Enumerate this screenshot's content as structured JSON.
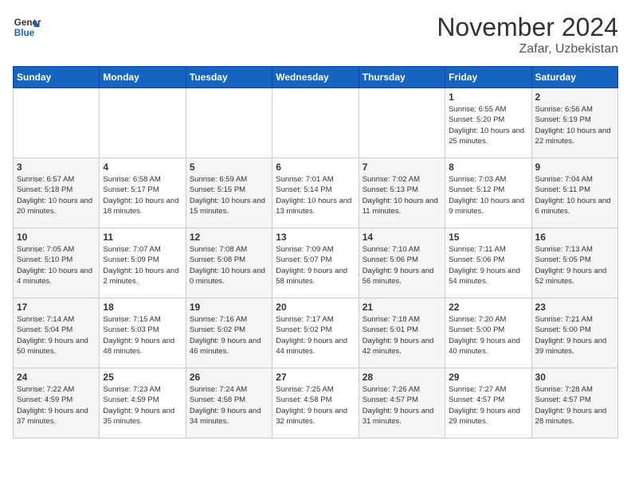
{
  "header": {
    "logo_line1": "General",
    "logo_line2": "Blue",
    "month": "November 2024",
    "location": "Zafar, Uzbekistan"
  },
  "weekdays": [
    "Sunday",
    "Monday",
    "Tuesday",
    "Wednesday",
    "Thursday",
    "Friday",
    "Saturday"
  ],
  "weeks": [
    [
      {
        "day": "",
        "info": ""
      },
      {
        "day": "",
        "info": ""
      },
      {
        "day": "",
        "info": ""
      },
      {
        "day": "",
        "info": ""
      },
      {
        "day": "",
        "info": ""
      },
      {
        "day": "1",
        "info": "Sunrise: 6:55 AM\nSunset: 5:20 PM\nDaylight: 10 hours and 25 minutes."
      },
      {
        "day": "2",
        "info": "Sunrise: 6:56 AM\nSunset: 5:19 PM\nDaylight: 10 hours and 22 minutes."
      }
    ],
    [
      {
        "day": "3",
        "info": "Sunrise: 6:57 AM\nSunset: 5:18 PM\nDaylight: 10 hours and 20 minutes."
      },
      {
        "day": "4",
        "info": "Sunrise: 6:58 AM\nSunset: 5:17 PM\nDaylight: 10 hours and 18 minutes."
      },
      {
        "day": "5",
        "info": "Sunrise: 6:59 AM\nSunset: 5:15 PM\nDaylight: 10 hours and 15 minutes."
      },
      {
        "day": "6",
        "info": "Sunrise: 7:01 AM\nSunset: 5:14 PM\nDaylight: 10 hours and 13 minutes."
      },
      {
        "day": "7",
        "info": "Sunrise: 7:02 AM\nSunset: 5:13 PM\nDaylight: 10 hours and 11 minutes."
      },
      {
        "day": "8",
        "info": "Sunrise: 7:03 AM\nSunset: 5:12 PM\nDaylight: 10 hours and 9 minutes."
      },
      {
        "day": "9",
        "info": "Sunrise: 7:04 AM\nSunset: 5:11 PM\nDaylight: 10 hours and 6 minutes."
      }
    ],
    [
      {
        "day": "10",
        "info": "Sunrise: 7:05 AM\nSunset: 5:10 PM\nDaylight: 10 hours and 4 minutes."
      },
      {
        "day": "11",
        "info": "Sunrise: 7:07 AM\nSunset: 5:09 PM\nDaylight: 10 hours and 2 minutes."
      },
      {
        "day": "12",
        "info": "Sunrise: 7:08 AM\nSunset: 5:08 PM\nDaylight: 10 hours and 0 minutes."
      },
      {
        "day": "13",
        "info": "Sunrise: 7:09 AM\nSunset: 5:07 PM\nDaylight: 9 hours and 58 minutes."
      },
      {
        "day": "14",
        "info": "Sunrise: 7:10 AM\nSunset: 5:06 PM\nDaylight: 9 hours and 56 minutes."
      },
      {
        "day": "15",
        "info": "Sunrise: 7:11 AM\nSunset: 5:06 PM\nDaylight: 9 hours and 54 minutes."
      },
      {
        "day": "16",
        "info": "Sunrise: 7:13 AM\nSunset: 5:05 PM\nDaylight: 9 hours and 52 minutes."
      }
    ],
    [
      {
        "day": "17",
        "info": "Sunrise: 7:14 AM\nSunset: 5:04 PM\nDaylight: 9 hours and 50 minutes."
      },
      {
        "day": "18",
        "info": "Sunrise: 7:15 AM\nSunset: 5:03 PM\nDaylight: 9 hours and 48 minutes."
      },
      {
        "day": "19",
        "info": "Sunrise: 7:16 AM\nSunset: 5:02 PM\nDaylight: 9 hours and 46 minutes."
      },
      {
        "day": "20",
        "info": "Sunrise: 7:17 AM\nSunset: 5:02 PM\nDaylight: 9 hours and 44 minutes."
      },
      {
        "day": "21",
        "info": "Sunrise: 7:18 AM\nSunset: 5:01 PM\nDaylight: 9 hours and 42 minutes."
      },
      {
        "day": "22",
        "info": "Sunrise: 7:20 AM\nSunset: 5:00 PM\nDaylight: 9 hours and 40 minutes."
      },
      {
        "day": "23",
        "info": "Sunrise: 7:21 AM\nSunset: 5:00 PM\nDaylight: 9 hours and 39 minutes."
      }
    ],
    [
      {
        "day": "24",
        "info": "Sunrise: 7:22 AM\nSunset: 4:59 PM\nDaylight: 9 hours and 37 minutes."
      },
      {
        "day": "25",
        "info": "Sunrise: 7:23 AM\nSunset: 4:59 PM\nDaylight: 9 hours and 35 minutes."
      },
      {
        "day": "26",
        "info": "Sunrise: 7:24 AM\nSunset: 4:58 PM\nDaylight: 9 hours and 34 minutes."
      },
      {
        "day": "27",
        "info": "Sunrise: 7:25 AM\nSunset: 4:58 PM\nDaylight: 9 hours and 32 minutes."
      },
      {
        "day": "28",
        "info": "Sunrise: 7:26 AM\nSunset: 4:57 PM\nDaylight: 9 hours and 31 minutes."
      },
      {
        "day": "29",
        "info": "Sunrise: 7:27 AM\nSunset: 4:57 PM\nDaylight: 9 hours and 29 minutes."
      },
      {
        "day": "30",
        "info": "Sunrise: 7:28 AM\nSunset: 4:57 PM\nDaylight: 9 hours and 28 minutes."
      }
    ]
  ]
}
